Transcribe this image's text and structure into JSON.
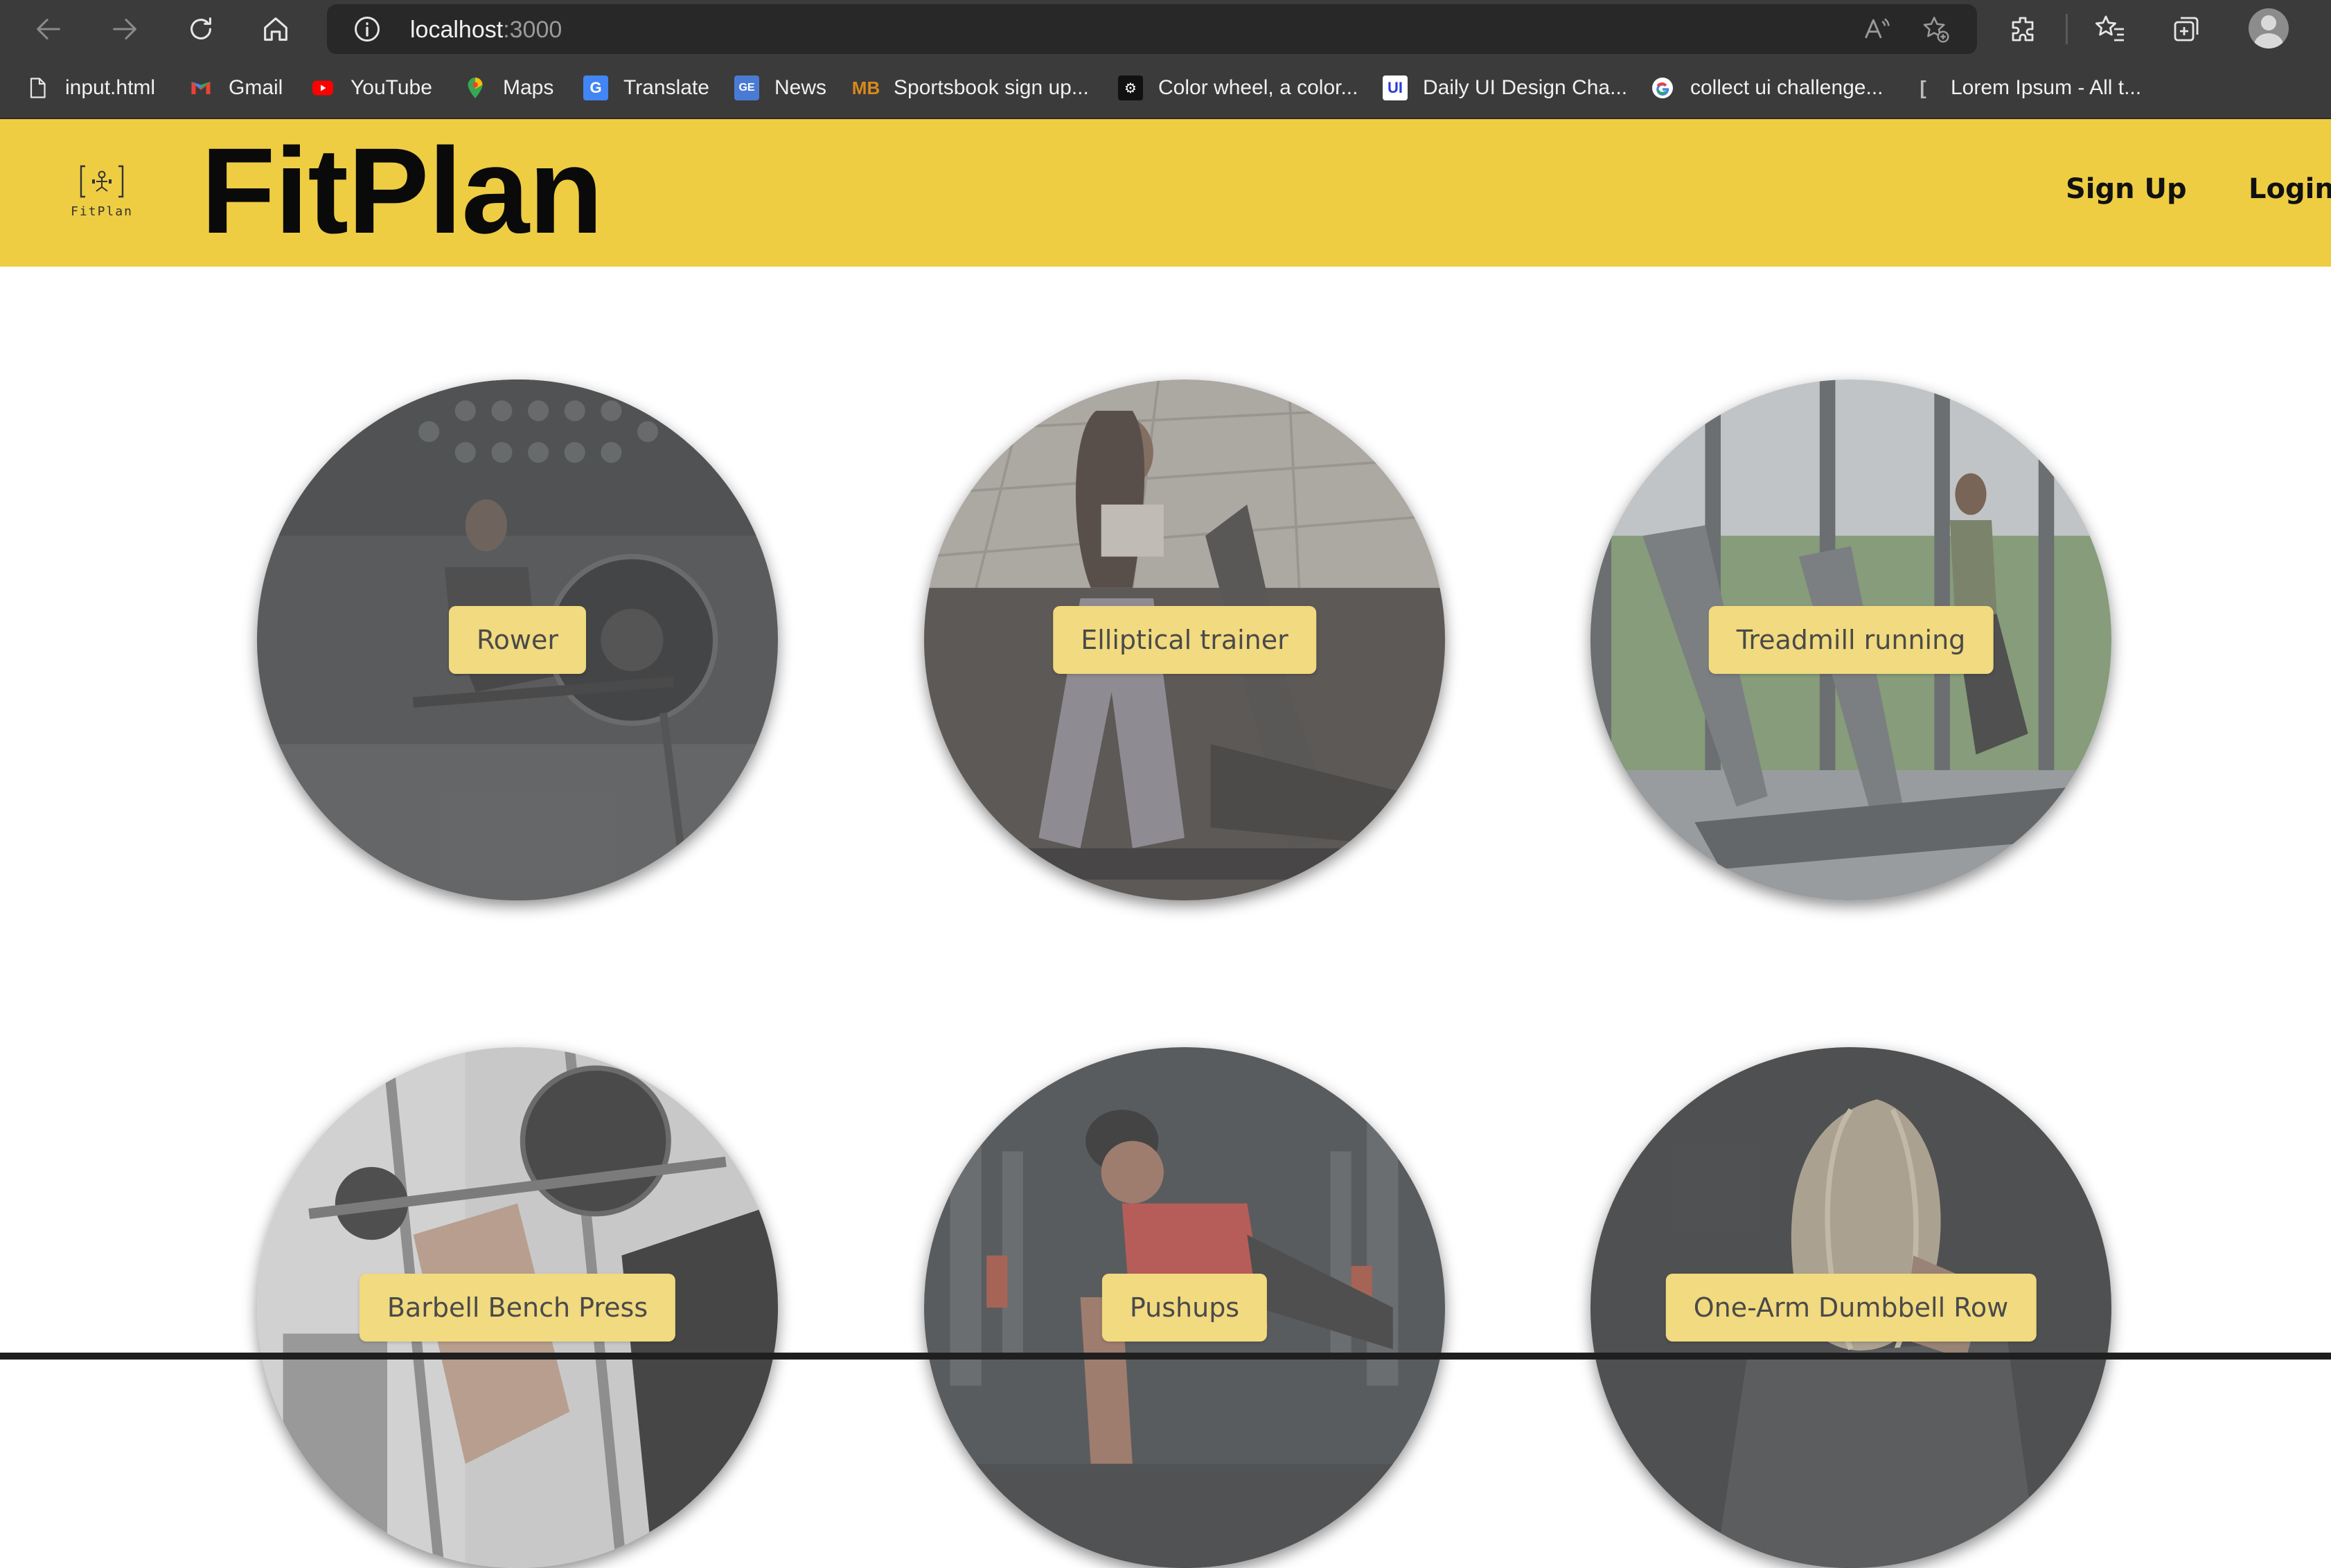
{
  "browser": {
    "address": {
      "host": "localhost",
      "port": ":3000"
    },
    "bookmarks": [
      {
        "label": "input.html",
        "icon": "file-icon"
      },
      {
        "label": "Gmail",
        "icon": "gmail-icon"
      },
      {
        "label": "YouTube",
        "icon": "youtube-icon"
      },
      {
        "label": "Maps",
        "icon": "maps-icon"
      },
      {
        "label": "Translate",
        "icon": "translate-icon"
      },
      {
        "label": "News",
        "icon": "news-icon"
      },
      {
        "label": "Sportsbook sign up...",
        "icon": "sportsbook-icon"
      },
      {
        "label": "Color wheel, a color...",
        "icon": "color-wheel-icon"
      },
      {
        "label": "Daily UI Design Cha...",
        "icon": "daily-ui-icon"
      },
      {
        "label": "collect ui challenge...",
        "icon": "google-icon"
      },
      {
        "label": "Lorem Ipsum - All t...",
        "icon": "lorem-icon"
      }
    ]
  },
  "header": {
    "logo_text": "FitPlan",
    "title": "FitPlan",
    "nav": {
      "signup": "Sign Up",
      "login": "Login"
    }
  },
  "exercises": [
    {
      "label": "Rower"
    },
    {
      "label": "Elliptical trainer"
    },
    {
      "label": "Treadmill running"
    },
    {
      "label": "Barbell Bench Press"
    },
    {
      "label": "Pushups"
    },
    {
      "label": "One-Arm Dumbbell Row"
    }
  ],
  "colors": {
    "header_bg": "#eecd43",
    "label_bg": "#f1da7f",
    "chrome_bg": "#3b3b3b"
  }
}
